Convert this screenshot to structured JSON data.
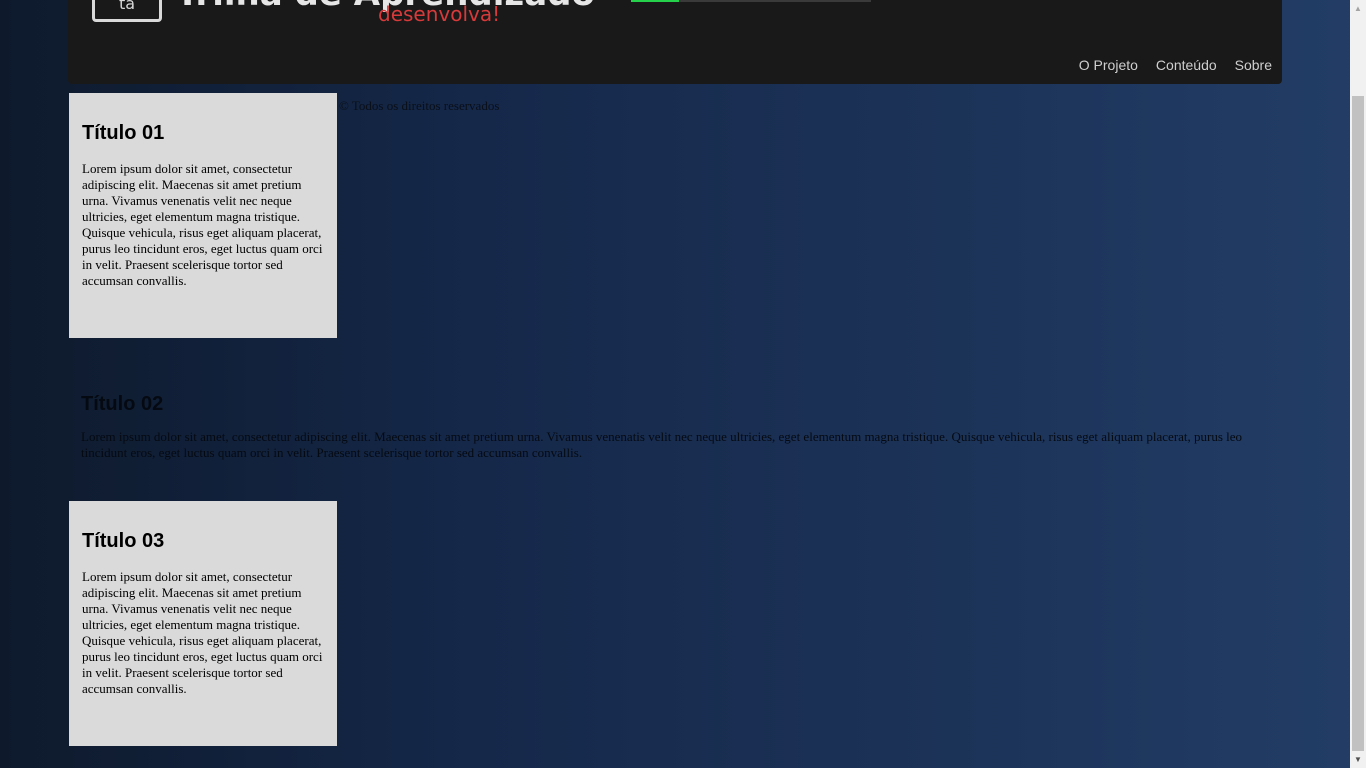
{
  "header": {
    "logo_box_text": "ta",
    "logo_title": "Trilha de Aprendizado",
    "logo_subtitle": "desenvolva!",
    "progress_fraction": 0.2,
    "nav": [
      {
        "label": "O Projeto"
      },
      {
        "label": "Conteúdo"
      },
      {
        "label": "Sobre"
      }
    ]
  },
  "footer": {
    "copyright": "© Todos os direitos reservados"
  },
  "sections": [
    {
      "title": "Título 01",
      "text": "Lorem ipsum dolor sit amet, consectetur adipiscing elit. Maecenas sit amet pretium urna. Vivamus venenatis velit nec neque ultricies, eget elementum magna tristique. Quisque vehicula, risus eget aliquam placerat, purus leo tincidunt eros, eget luctus quam orci in velit. Praesent scelerisque tortor sed accumsan convallis."
    },
    {
      "title": "Título 02",
      "text": "Lorem ipsum dolor sit amet, consectetur adipiscing elit. Maecenas sit amet pretium urna. Vivamus venenatis velit nec neque ultricies, eget elementum magna tristique. Quisque vehicula, risus eget aliquam placerat, purus leo tincidunt eros, eget luctus quam orci in velit. Praesent scelerisque tortor sed accumsan convallis."
    },
    {
      "title": "Título 03",
      "text": "Lorem ipsum dolor sit amet, consectetur adipiscing elit. Maecenas sit amet pretium urna. Vivamus venenatis velit nec neque ultricies, eget elementum magna tristique. Quisque vehicula, risus eget aliquam placerat, purus leo tincidunt eros, eget luctus quam orci in velit. Praesent scelerisque tortor sed accumsan convallis."
    }
  ],
  "colors": {
    "header_bg": "#191919",
    "card_bg": "#dadada",
    "accent_red": "#d63a3a",
    "progress_green": "#25d04a"
  }
}
